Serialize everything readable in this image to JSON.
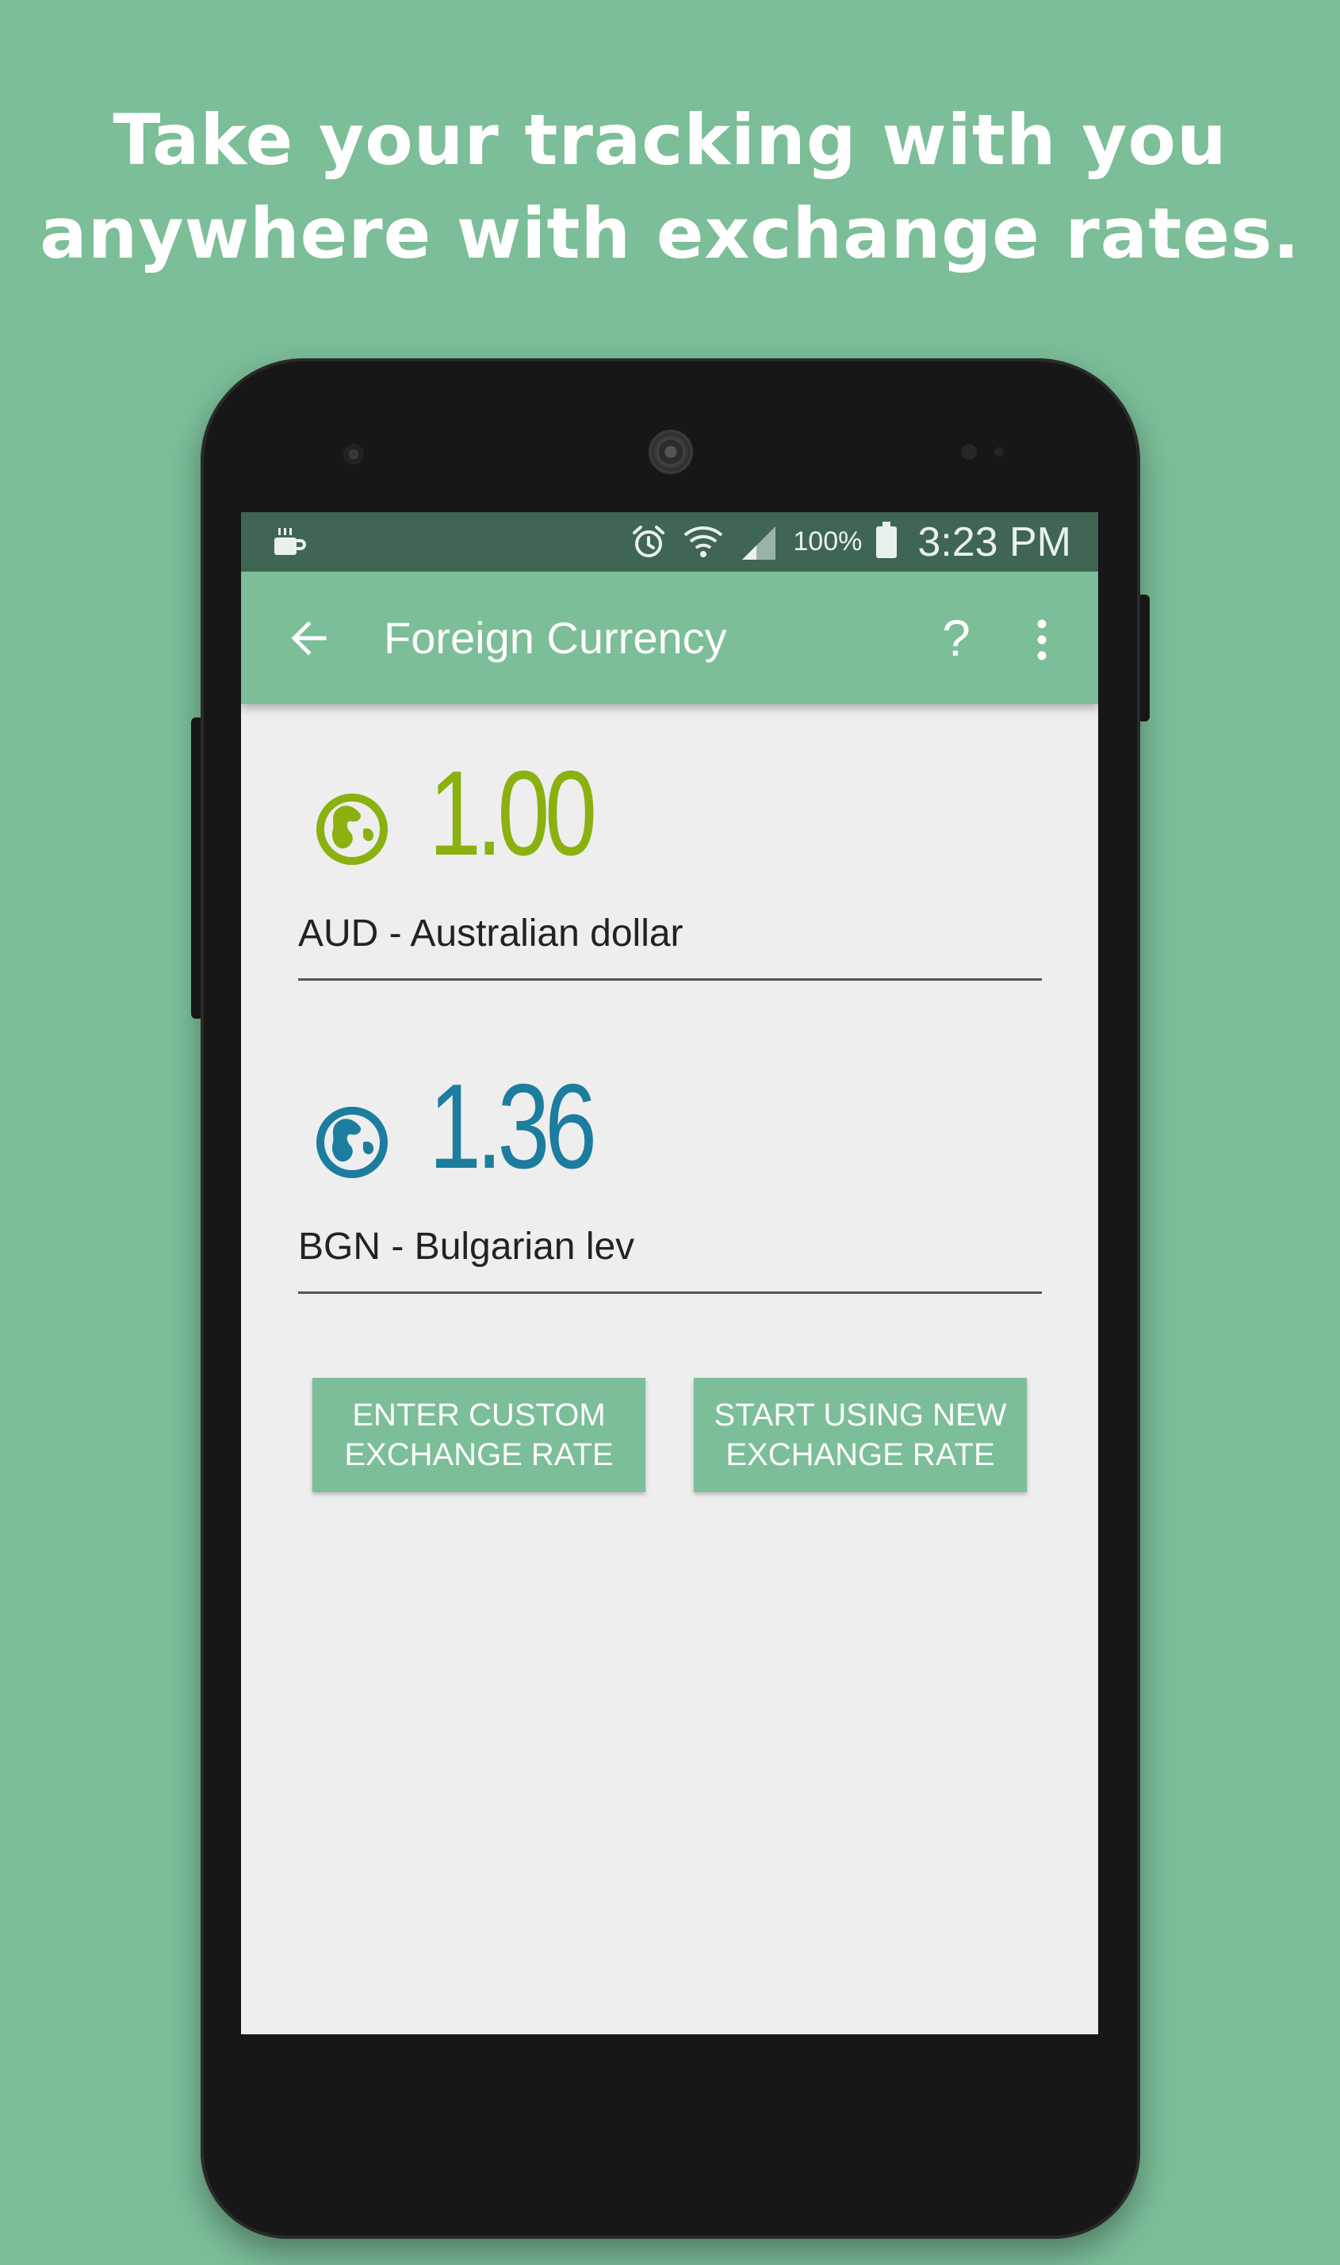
{
  "promo": {
    "line1": "Take your tracking with you",
    "line2": "anywhere with exchange rates."
  },
  "statusbar": {
    "battery_percent": "100%",
    "time": "3:23 PM",
    "icons": [
      "coffee-notification-icon",
      "alarm-icon",
      "wifi-icon",
      "signal-icon",
      "battery-icon"
    ]
  },
  "appbar": {
    "title": "Foreign Currency",
    "help": "?",
    "icons": [
      "back-arrow-icon",
      "help-icon",
      "more-vert-icon"
    ]
  },
  "currencies": [
    {
      "amount": "1.00",
      "label": "AUD - Australian dollar",
      "color": "#8ab10f",
      "icon": "globe-icon"
    },
    {
      "amount": "1.36",
      "label": "BGN - Bulgarian lev",
      "color": "#1c7d9e",
      "icon": "globe-icon"
    }
  ],
  "buttons": {
    "custom_rate": "ENTER CUSTOM EXCHANGE RATE",
    "new_rate": "START USING NEW EXCHANGE RATE"
  },
  "colors": {
    "background": "#7bbe98",
    "statusbar": "#3f6553",
    "screen": "#eeeeee"
  }
}
